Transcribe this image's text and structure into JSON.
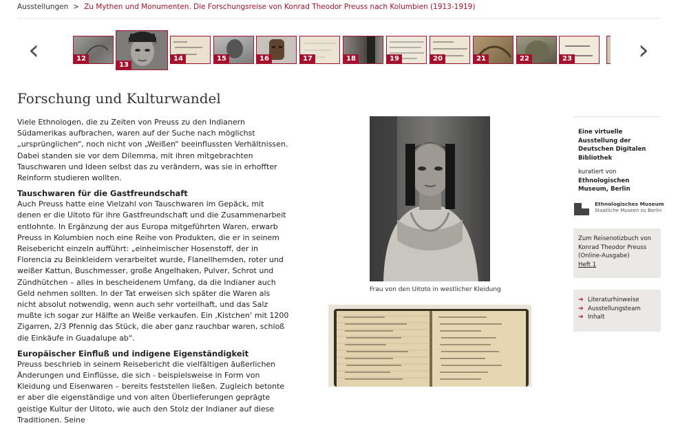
{
  "breadcrumb": {
    "root": "Ausstellungen",
    "separator": ">",
    "current": "Zu Mythen und Monumenten. Die Forschungsreise von Konrad Theodor Preuss nach Kolumbien (1913-1919)"
  },
  "gallery": {
    "prev_icon": "‹",
    "next_icon": "›",
    "thumbs": [
      {
        "num": "12"
      },
      {
        "num": "13"
      },
      {
        "num": "14"
      },
      {
        "num": "15"
      },
      {
        "num": "16"
      },
      {
        "num": "17"
      },
      {
        "num": "18"
      },
      {
        "num": "19"
      },
      {
        "num": "20"
      },
      {
        "num": "21"
      },
      {
        "num": "22"
      },
      {
        "num": "23"
      }
    ],
    "active": "13"
  },
  "article": {
    "title": "Forschung und Kulturwandel",
    "intro": "Viele Ethnologen, die zu Zeiten von Preuss zu den Indianern Südamerikas aufbrachen, waren auf der Suche nach möglichst „ursprünglichen“, noch nicht von „Weißen“ beeinflussten Verhältnissen. Dabei standen sie vor dem Dilemma, mit ihren mitgebrachten Tauschwaren und Ideen selbst das zu verändern, was sie in erhoffter Reinform studieren wollten.",
    "h1": "Tauschwaren für die Gastfreundschaft",
    "p1": "Auch Preuss hatte eine Vielzahl von Tauschwaren im Gepäck, mit denen er die Uitoto für ihre Gastfreundschaft und die Zusammenarbeit entlohnte. In Ergänzung der aus Europa mitgeführten Waren, erwarb Preuss in Kolumbien noch eine Reihe von Produkten, die er in seinem Reisebericht einzeln aufführt: „einheimischer Hosenstoff, der in Florencia zu Beinkleidern verarbeitet wurde, Flanellhemden, roter und weißer Kattun, Buschmesser, große Angelhaken, Pulver, Schrot und Zündhütchen – alles in bescheidenem Umfang, da die Indianer auch Geld nehmen sollten. In der Tat erweisen sich später die Waren als nicht absolut notwendig, wenn auch sehr vorteilhaft, und das Salz mußte ich sogar zur Hälfte an Weiße verkaufen. Ein ‚Kistchen‘ mit 1200 Zigarren, 2/3 Pfennig das Stück, die aber ganz rauchbar waren, schloß die Einkäufe in Guadalupe ab“.",
    "h2": "Europäischer Einfluß und indigene Eigenständigkeit",
    "p2": "Preuss beschrieb in seinem Reisebericht die vielfältigen äußerlichen Änderungen und Einflüsse, die sich - beispielsweise in Form von Kleidung und Eisenwaren – bereits feststellen ließen. Zugleich betonte er aber die eigenständige und von alten Überlieferungen geprägte geistige Kultur der Uitoto, wie auch den Stolz der Indianer auf diese Traditionen. Seine"
  },
  "figures": {
    "caption1": "Frau von den Uitoto in westlicher Kleidung"
  },
  "sidebar": {
    "info_bold": "Eine virtuelle Ausstellung der Deutschen Digitalen Bibliothek",
    "curated_label": "kuratiert von",
    "curator": "Ethnologischen Museum, Berlin",
    "logo_title": "Ethnologisches Museum",
    "logo_sub": "Staatliche Museen zu Berlin",
    "notebook_text": "Zum Reisenotizbuch von Konrad Theodor Preuss (Online-Ausgabe)",
    "notebook_link": "Heft 1",
    "links": [
      "Literaturhinweise",
      "Ausstellungsteam",
      "Inhalt"
    ]
  },
  "colors": {
    "accent": "#a3112c",
    "sidebar_bg": "#ebe9e6"
  }
}
